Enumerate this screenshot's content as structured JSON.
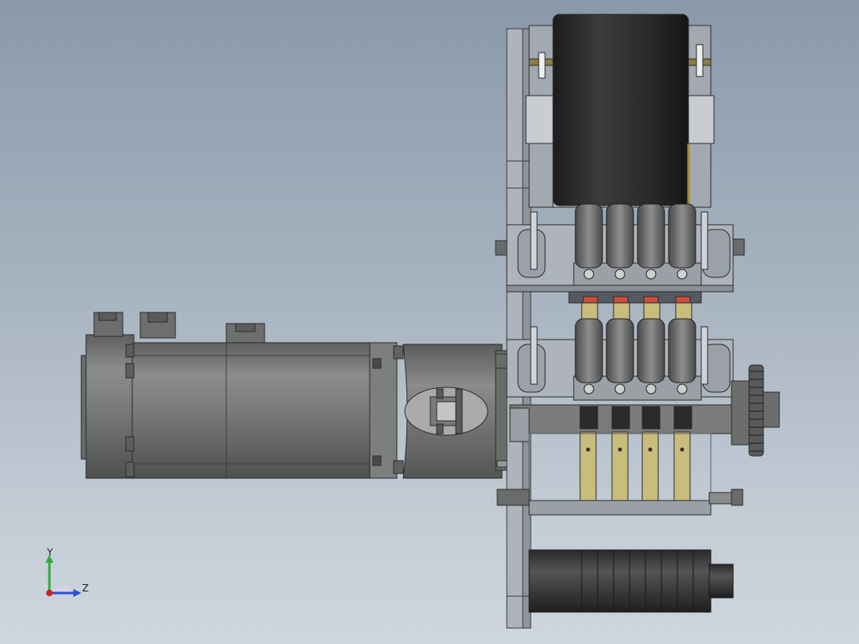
{
  "viewport": {
    "background_top": "#8a99aa",
    "background_bottom": "#cfd6dd"
  },
  "triad": {
    "y_label": "Y",
    "z_label": "Z",
    "y_color": "#2eaa3c",
    "z_color": "#2a4fd8",
    "x_color": "#d21e1e"
  },
  "model": {
    "body_color": "#7a7c7c",
    "dark_color": "#3a3a3a",
    "brass_color": "#c8bd7a",
    "frame_color": "#aeb4bc",
    "accent_red": "#c8503c"
  }
}
